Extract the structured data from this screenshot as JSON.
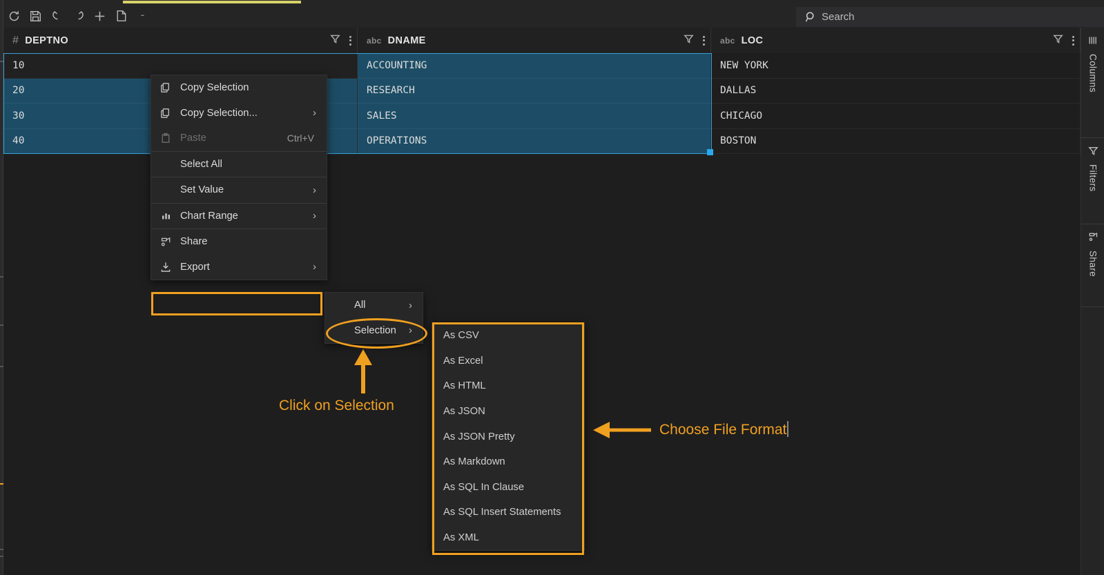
{
  "app": {
    "accent_orange": "#f0a020",
    "selection_blue": "#1d4d66",
    "tab_indicator_color": "#d7d16a"
  },
  "toolbar": {
    "items": [
      {
        "name": "refresh-icon",
        "label": "Refresh"
      },
      {
        "name": "save-icon",
        "label": "Save"
      },
      {
        "name": "undo-icon",
        "label": "Undo"
      },
      {
        "name": "redo-icon",
        "label": "Redo"
      },
      {
        "name": "add-row-icon",
        "label": "Add Row"
      },
      {
        "name": "duplicate-row-icon",
        "label": "Duplicate Row"
      },
      {
        "name": "delete-row-icon",
        "label": "-"
      }
    ],
    "minus_label": "-"
  },
  "search": {
    "placeholder": "Search",
    "value": ""
  },
  "grid": {
    "columns": [
      {
        "name": "DEPTNO",
        "type_tag": "#",
        "type_kind": "number"
      },
      {
        "name": "DNAME",
        "type_tag": "abc",
        "type_kind": "text"
      },
      {
        "name": "LOC",
        "type_tag": "abc",
        "type_kind": "text"
      }
    ],
    "rows": [
      {
        "DEPTNO": "10",
        "DNAME": "ACCOUNTING",
        "LOC": "NEW YORK"
      },
      {
        "DEPTNO": "20",
        "DNAME": "RESEARCH",
        "LOC": "DALLAS"
      },
      {
        "DEPTNO": "30",
        "DNAME": "SALES",
        "LOC": "CHICAGO"
      },
      {
        "DEPTNO": "40",
        "DNAME": "OPERATIONS",
        "LOC": "BOSTON"
      }
    ]
  },
  "right_sidebar": {
    "tabs": [
      {
        "label": "Columns",
        "icon": "columns-icon"
      },
      {
        "label": "Filters",
        "icon": "filter-icon"
      },
      {
        "label": "Share",
        "icon": "share-icon"
      }
    ]
  },
  "context_menu": {
    "items": [
      {
        "label": "Copy Selection",
        "icon": "copy-icon",
        "shortcut": "",
        "submenu": false,
        "disabled": false
      },
      {
        "label": "Copy Selection...",
        "icon": "copy-icon",
        "shortcut": "",
        "submenu": true,
        "disabled": false
      },
      {
        "label": "Paste",
        "icon": "paste-icon",
        "shortcut": "Ctrl+V",
        "submenu": false,
        "disabled": true
      },
      {
        "label": "Select All",
        "icon": "",
        "shortcut": "",
        "submenu": false,
        "disabled": false
      },
      {
        "label": "Set Value",
        "icon": "",
        "shortcut": "",
        "submenu": true,
        "disabled": false
      },
      {
        "label": "Chart Range",
        "icon": "chart-icon",
        "shortcut": "",
        "submenu": true,
        "disabled": false
      },
      {
        "label": "Share",
        "icon": "share-icon",
        "shortcut": "",
        "submenu": false,
        "disabled": false
      },
      {
        "label": "Export",
        "icon": "export-icon",
        "shortcut": "",
        "submenu": true,
        "disabled": false
      }
    ]
  },
  "export_submenu": {
    "items": [
      {
        "label": "All",
        "submenu": true
      },
      {
        "label": "Selection",
        "submenu": true
      }
    ]
  },
  "format_submenu": {
    "items": [
      {
        "label": "As CSV"
      },
      {
        "label": "As Excel"
      },
      {
        "label": "As HTML"
      },
      {
        "label": "As JSON"
      },
      {
        "label": "As JSON Pretty"
      },
      {
        "label": "As Markdown"
      },
      {
        "label": "As SQL In Clause"
      },
      {
        "label": "As SQL Insert Statements"
      },
      {
        "label": "As XML"
      }
    ]
  },
  "annotations": {
    "click_selection": "Click on Selection",
    "choose_format": "Choose File Format"
  }
}
